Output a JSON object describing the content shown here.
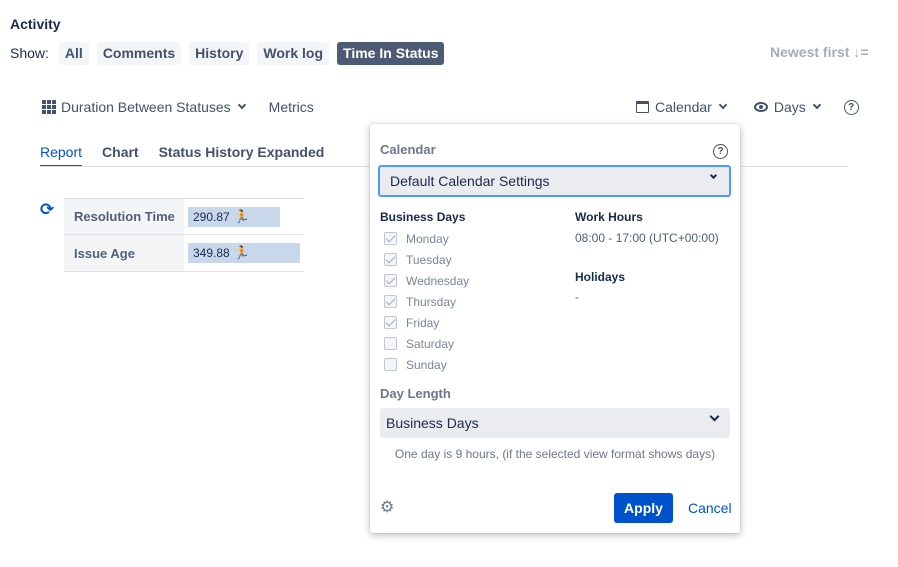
{
  "activity": {
    "title": "Activity",
    "show_label": "Show:",
    "filters": [
      "All",
      "Comments",
      "History",
      "Work log",
      "Time In Status"
    ],
    "active_filter": "Time In Status",
    "sort_label": "Newest first"
  },
  "toolbar": {
    "duration_label": "Duration Between Statuses",
    "metrics_label": "Metrics",
    "calendar_label": "Calendar",
    "days_label": "Days",
    "help_glyph": "?"
  },
  "tabs": [
    "Report",
    "Chart",
    "Status History Expanded"
  ],
  "report": {
    "rows": [
      {
        "label": "Resolution Time",
        "value": "290.87",
        "fraction": 0.77
      },
      {
        "label": "Issue Age",
        "value": "349.88",
        "fraction": 0.93
      }
    ]
  },
  "popup": {
    "title": "Calendar",
    "help_glyph": "?",
    "calendar_select": "Default Calendar Settings",
    "business_days_title": "Business Days",
    "days": [
      {
        "name": "Monday",
        "checked": true
      },
      {
        "name": "Tuesday",
        "checked": true
      },
      {
        "name": "Wednesday",
        "checked": true
      },
      {
        "name": "Thursday",
        "checked": true
      },
      {
        "name": "Friday",
        "checked": true
      },
      {
        "name": "Saturday",
        "checked": false
      },
      {
        "name": "Sunday",
        "checked": false
      }
    ],
    "work_hours_title": "Work Hours",
    "work_hours_value": "08:00 - 17:00 (UTC+00:00)",
    "holidays_title": "Holidays",
    "holidays_value": "-",
    "day_length_title": "Day Length",
    "day_length_select": "Business Days",
    "day_length_note": "One day is 9 hours, (if the selected view format shows days)",
    "apply_label": "Apply",
    "cancel_label": "Cancel"
  },
  "colors": {
    "accent": "#0052cc",
    "active_filter_bg": "#4c5a75",
    "bar": "#c8d8ea"
  },
  "icons": [
    "grid-icon",
    "calendar-icon",
    "eye-icon",
    "help-icon",
    "refresh-icon",
    "runner-icon",
    "gear-icon",
    "sort-icon",
    "chevron-down-icon"
  ]
}
